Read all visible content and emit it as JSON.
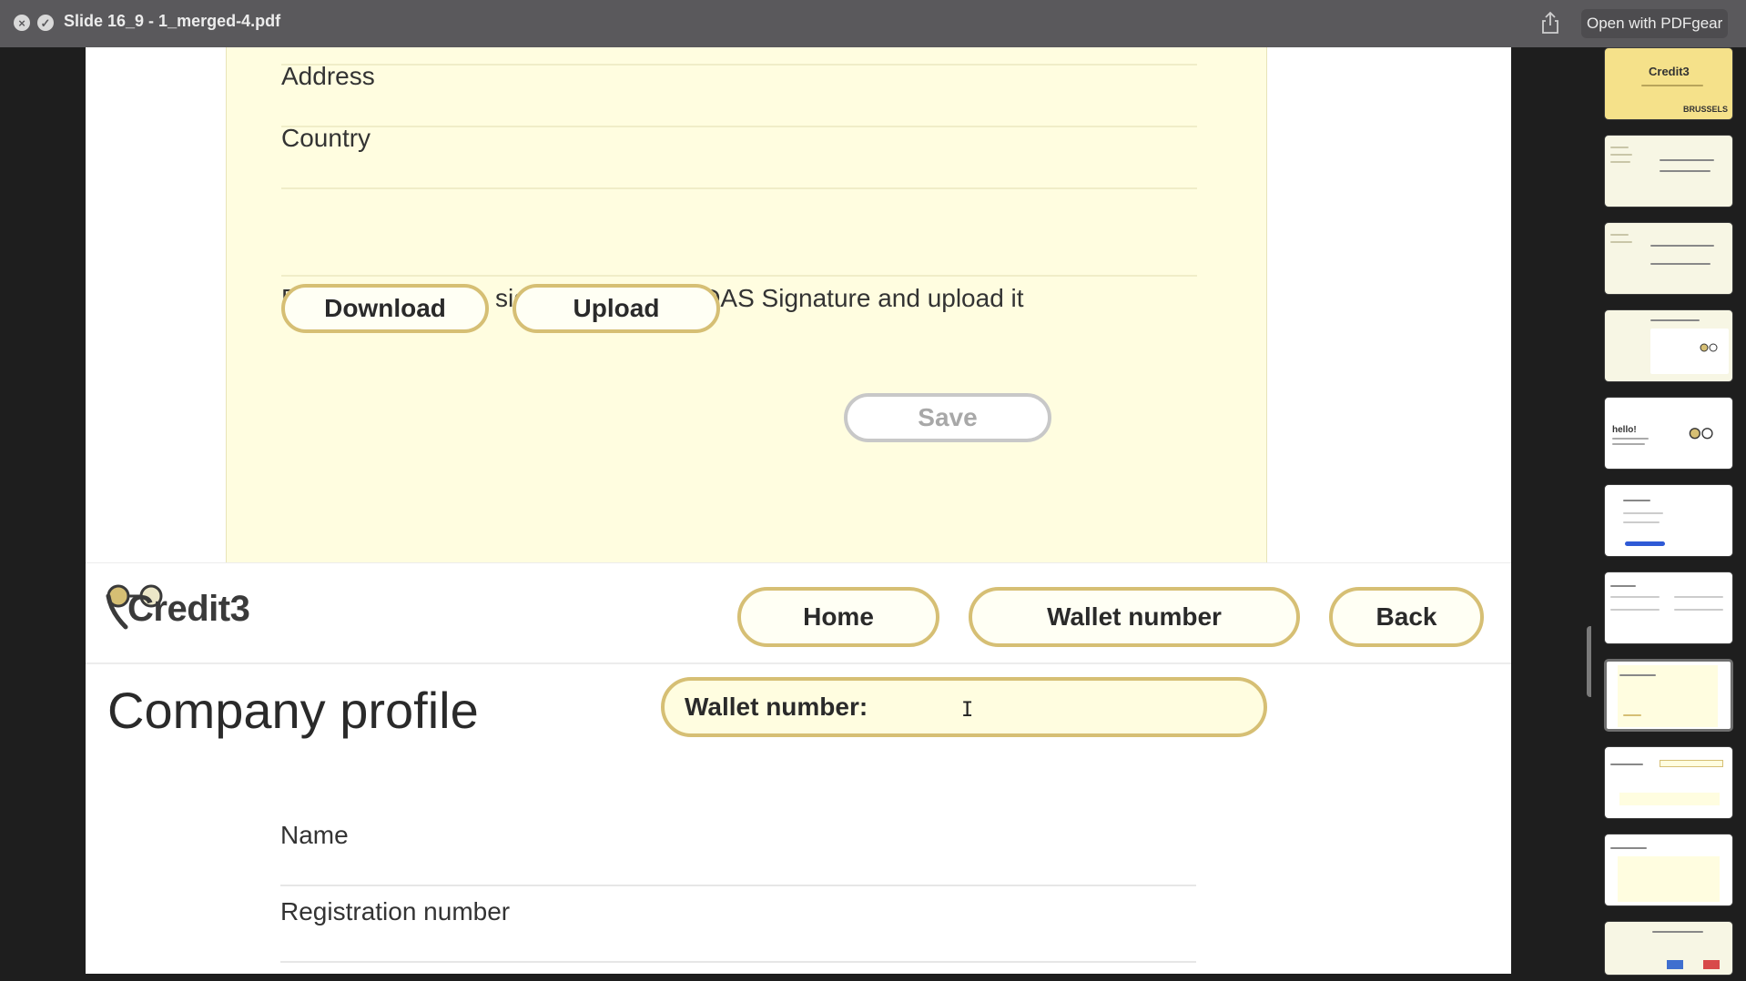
{
  "window": {
    "title": "Slide 16_9 - 1_merged-4.pdf",
    "open_with_label": "Open with PDFgear"
  },
  "form_top": {
    "fields": [
      "Address",
      "Country"
    ],
    "instruction": "Download this file, sign it with your EIDAS Signature and upload it",
    "download_label": "Download",
    "upload_label": "Upload",
    "save_label": "Save"
  },
  "header": {
    "logo_text": "Credit3",
    "nav": {
      "home": "Home",
      "wallet": "Wallet number",
      "back": "Back"
    }
  },
  "profile": {
    "title": "Company profile",
    "wallet_field_label": "Wallet number:",
    "fields": [
      "Name",
      "Registration number"
    ]
  },
  "sidebar": {
    "thumb_1_title": "Credit3",
    "thumb_1_badge": "BRUSSELS",
    "thumb_5_text": "hello!"
  },
  "colors": {
    "accent_border": "#d6bf74",
    "form_background": "#fffde0",
    "titlebar": "#5a595c"
  }
}
